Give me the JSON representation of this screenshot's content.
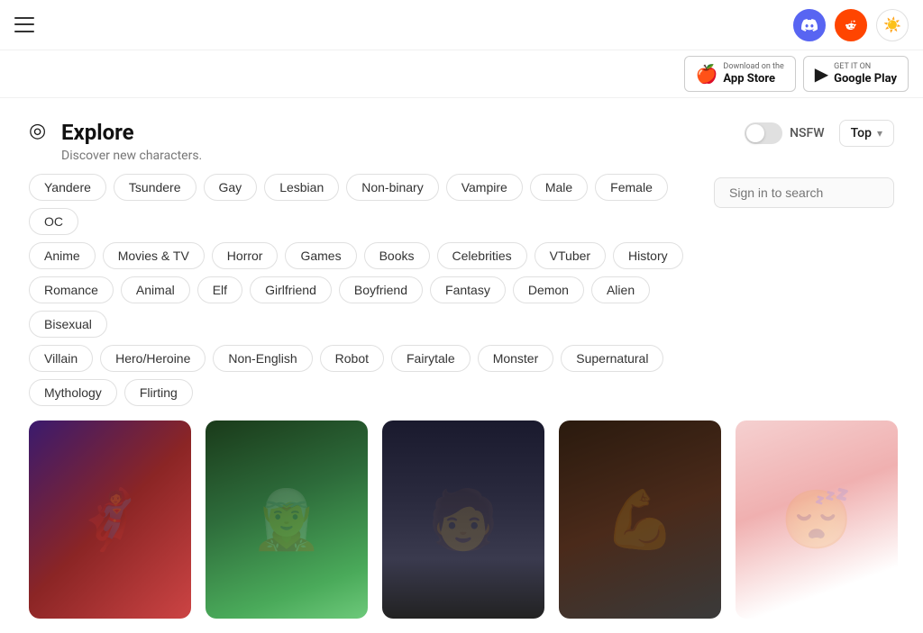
{
  "nav": {
    "discord_label": "discord",
    "reddit_label": "reddit",
    "theme_toggle": "☀",
    "app_store_small": "Download on the",
    "app_store_large": "App Store",
    "google_play_small": "GET IT ON",
    "google_play_large": "Google Play"
  },
  "explore": {
    "icon": "◎",
    "title": "Explore",
    "subtitle": "Discover new characters.",
    "nsfw_label": "NSFW",
    "top_label": "Top",
    "search_placeholder": "Sign in to search"
  },
  "tags": {
    "row1": [
      "Yandere",
      "Tsundere",
      "Gay",
      "Lesbian",
      "Non-binary",
      "Vampire",
      "Male",
      "Female",
      "OC"
    ],
    "row2": [
      "Anime",
      "Movies & TV",
      "Horror",
      "Games",
      "Books",
      "Celebrities",
      "VTuber",
      "History"
    ],
    "row3": [
      "Romance",
      "Animal",
      "Elf",
      "Girlfriend",
      "Boyfriend",
      "Fantasy",
      "Demon",
      "Alien",
      "Bisexual"
    ],
    "row4": [
      "Villain",
      "Hero/Heroine",
      "Non-English",
      "Robot",
      "Fairytale",
      "Monster",
      "Supernatural"
    ],
    "row5": [
      "Mythology",
      "Flirting"
    ]
  },
  "cards": [
    {
      "id": 1,
      "class": "card-1"
    },
    {
      "id": 2,
      "class": "card-2"
    },
    {
      "id": 3,
      "class": "card-3"
    },
    {
      "id": 4,
      "class": "card-4"
    },
    {
      "id": 5,
      "class": "card-5"
    }
  ]
}
